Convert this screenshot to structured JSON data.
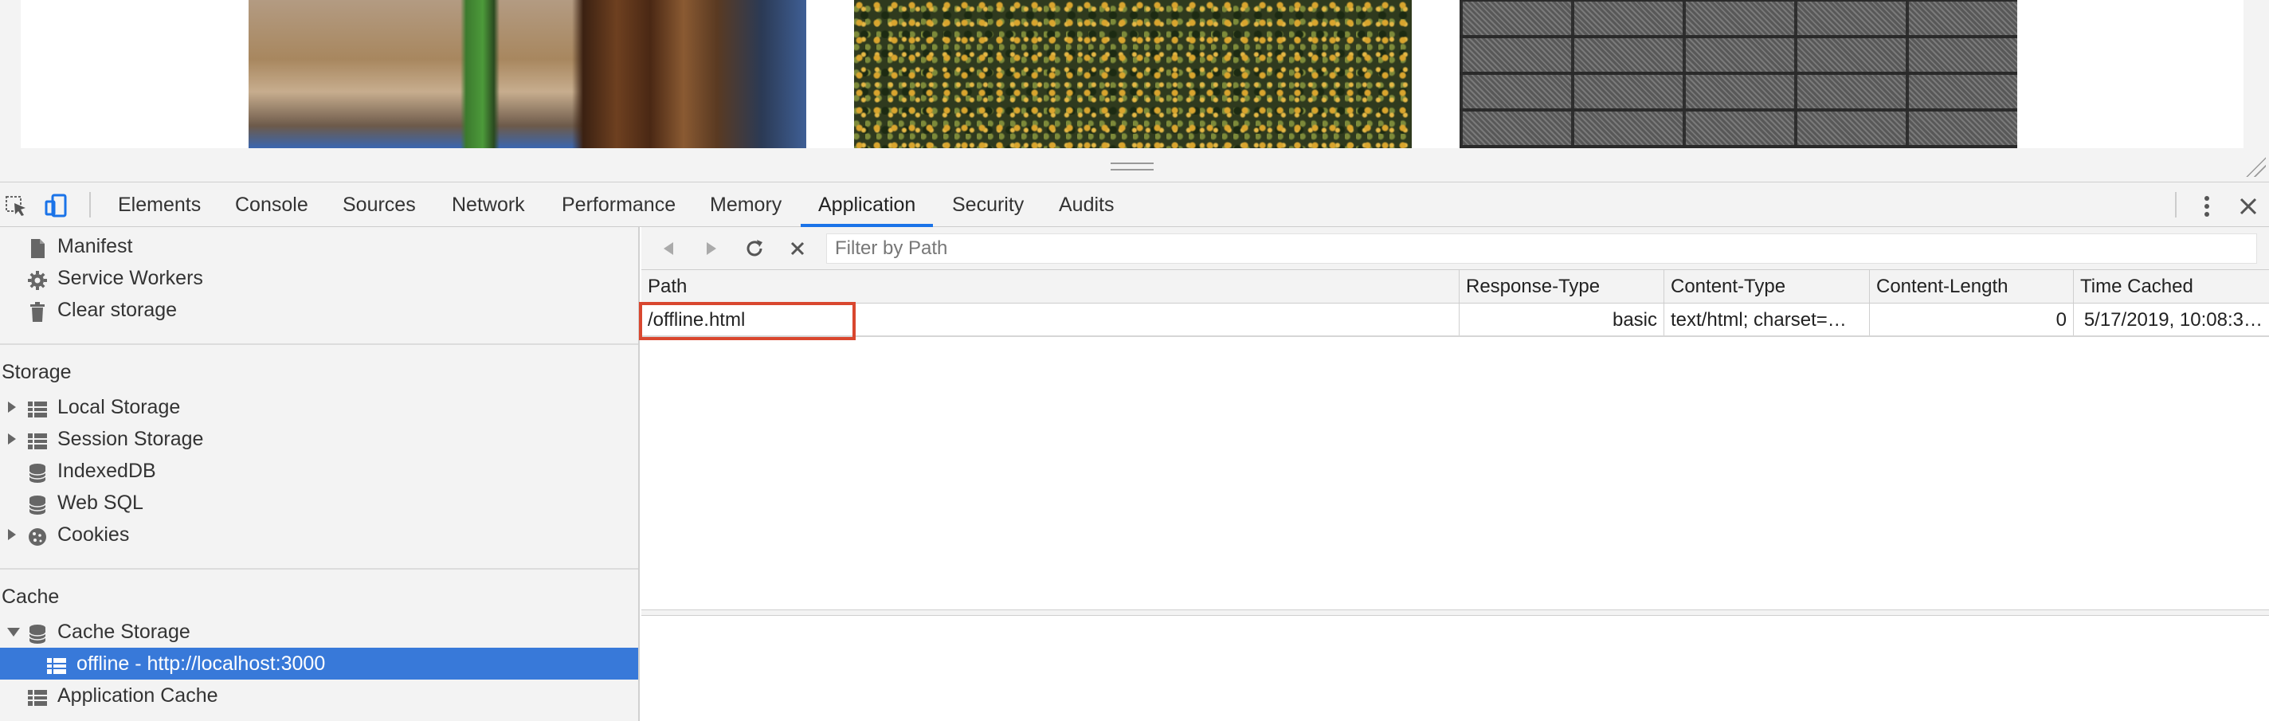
{
  "devtools": {
    "tabs": [
      "Elements",
      "Console",
      "Sources",
      "Network",
      "Performance",
      "Memory",
      "Application",
      "Security",
      "Audits"
    ],
    "active_tab": "Application"
  },
  "page": {
    "images": [
      "cafe-interior-photo",
      "forest-aerial-photo",
      "brick-wall-photo"
    ]
  },
  "sidebar": {
    "top_items": [
      {
        "label": "Manifest",
        "icon": "document-icon"
      },
      {
        "label": "Service Workers",
        "icon": "gear-icon"
      },
      {
        "label": "Clear storage",
        "icon": "trash-icon"
      }
    ],
    "storage_heading": "Storage",
    "storage_items": [
      {
        "label": "Local Storage",
        "icon": "grid-icon",
        "expandable": true
      },
      {
        "label": "Session Storage",
        "icon": "grid-icon",
        "expandable": true
      },
      {
        "label": "IndexedDB",
        "icon": "database-icon",
        "expandable": false
      },
      {
        "label": "Web SQL",
        "icon": "database-icon",
        "expandable": false
      },
      {
        "label": "Cookies",
        "icon": "cookie-icon",
        "expandable": true
      }
    ],
    "cache_heading": "Cache",
    "cache_items": [
      {
        "label": "Cache Storage",
        "icon": "database-icon",
        "expanded": true
      },
      {
        "label": "offline - http://localhost:3000",
        "icon": "grid-icon",
        "selected": true
      },
      {
        "label": "Application Cache",
        "icon": "grid-icon"
      }
    ]
  },
  "cache_view": {
    "filter_placeholder": "Filter by Path",
    "filter_value": "",
    "columns": [
      "Path",
      "Response-Type",
      "Content-Type",
      "Content-Length",
      "Time Cached"
    ],
    "rows": [
      {
        "path": "/offline.html",
        "response_type": "basic",
        "content_type": "text/html; charset=…",
        "content_length": "0",
        "time_cached": "5/17/2019, 10:08:3…"
      }
    ]
  },
  "colors": {
    "accent": "#1a73e8",
    "selection": "#3879d9",
    "highlight_border": "#d9472f"
  }
}
